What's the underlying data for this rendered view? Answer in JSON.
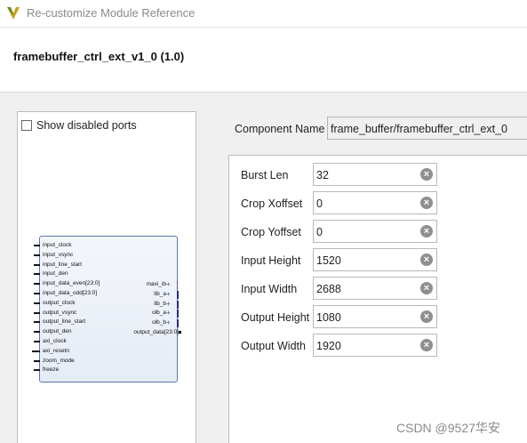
{
  "window": {
    "title": "Re-customize Module Reference"
  },
  "header": {
    "module_title": "framebuffer_ctrl_ext_v1_0 (1.0)"
  },
  "left_panel": {
    "show_disabled_label": "Show disabled ports",
    "show_disabled_checked": false,
    "left_ports": [
      "input_clock",
      "input_vsync",
      "input_line_start",
      "input_den",
      "input_data_even[23:0]",
      "input_data_odd[23:0]",
      "output_clock",
      "output_vsync",
      "output_line_start",
      "output_den",
      "axi_clock",
      "axi_resetn",
      "zoom_mode",
      "freeze"
    ],
    "right_ports": [
      "maxi_ib",
      "lib_a",
      "lib_b",
      "olb_a",
      "olb_b",
      "output_data[23:0]"
    ]
  },
  "component": {
    "label": "Component Name",
    "value": "frame_buffer/framebuffer_ctrl_ext_0"
  },
  "params": [
    {
      "label": "Burst Len",
      "value": "32"
    },
    {
      "label": "Crop Xoffset",
      "value": "0"
    },
    {
      "label": "Crop Yoffset",
      "value": "0"
    },
    {
      "label": "Input Height",
      "value": "1520"
    },
    {
      "label": "Input Width",
      "value": "2688"
    },
    {
      "label": "Output Height",
      "value": "1080"
    },
    {
      "label": "Output Width",
      "value": "1920"
    }
  ],
  "clear_icon_glyph": "×",
  "watermark": "CSDN @9527华安"
}
